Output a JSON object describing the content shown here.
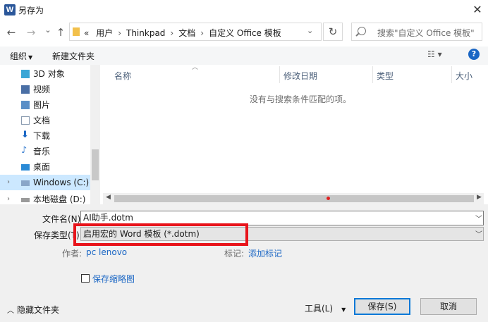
{
  "titlebar": {
    "title": "另存为",
    "app_icon_letter": "W",
    "close_glyph": "✕"
  },
  "nav": {
    "back_glyph": "←",
    "forward_glyph": "→",
    "recent_glyph": "⌄",
    "up_glyph": "↑",
    "address": {
      "overflow": "«",
      "crumbs": [
        "用户",
        "Thinkpad",
        "文档",
        "自定义 Office 模板"
      ],
      "separator": "›"
    },
    "refresh_glyph": "↻",
    "search_placeholder": "搜索\"自定义 Office 模板\""
  },
  "toolbar": {
    "organize": "组织",
    "new_folder": "新建文件夹",
    "view_glyph": "☷ ▾",
    "help_glyph": "?"
  },
  "navpane": {
    "items": [
      {
        "label": "3D 对象",
        "color": "#3aa6d6"
      },
      {
        "label": "视频",
        "color": "#4a6fa5"
      },
      {
        "label": "图片",
        "color": "#5a8fc7"
      },
      {
        "label": "文档",
        "color": "#8a9bb0"
      },
      {
        "label": "下载",
        "color": "#1a66c4"
      },
      {
        "label": "音乐",
        "color": "#3a7fd0"
      },
      {
        "label": "桌面",
        "color": "#2a8ad6"
      },
      {
        "label": "Windows (C:)",
        "color": "#5b86b8"
      },
      {
        "label": "本地磁盘 (D:)",
        "color": "#7a7a7a"
      }
    ],
    "expand_glyph": "›"
  },
  "filelist": {
    "columns": [
      "名称",
      "修改日期",
      "类型",
      "大小"
    ],
    "empty_message": "没有与搜索条件匹配的项。"
  },
  "form": {
    "filename_label": "文件名(N):",
    "filename_value": "AI助手.dotm",
    "filetype_label": "保存类型(T):",
    "filetype_value": "启用宏的 Word 模板 (*.dotm)",
    "author_label": "作者:",
    "author_value": "pc lenovo",
    "tags_label": "标记:",
    "tags_value": "添加标记",
    "thumbnail_label": "保存缩略图"
  },
  "footer": {
    "hide_folders": "隐藏文件夹",
    "tools": "工具(L)",
    "save": "保存(S)",
    "cancel": "取消"
  },
  "colors": {
    "accent": "#0078d7",
    "highlight": "#e8141b",
    "link": "#1a66c4"
  }
}
